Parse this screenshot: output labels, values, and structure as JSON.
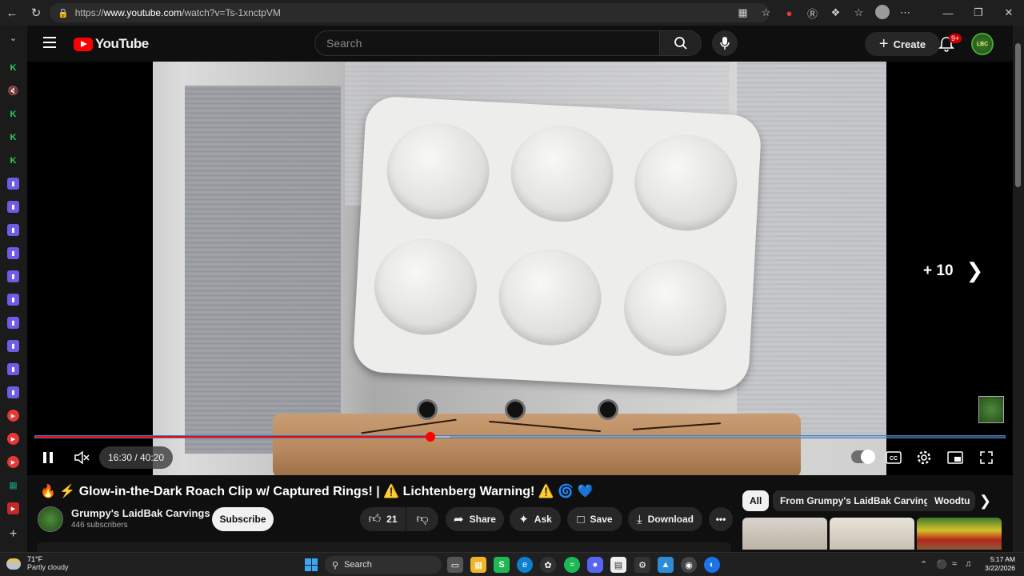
{
  "browser": {
    "url_prefix": "https://",
    "url_host": "www.youtube.com",
    "url_path": "/watch?v=Ts-1xnctpVM"
  },
  "youtube": {
    "logo_text": "YouTube",
    "search_placeholder": "Search",
    "create_label": "Create",
    "notification_count": "9+",
    "account_initials": "LBC"
  },
  "player": {
    "skip_label": "+ 10",
    "time_display": "16:30 / 40:20",
    "progress_fraction": 0.408,
    "buffered_fraction": 0.427
  },
  "video": {
    "title": "🔥 ⚡ Glow-in-the-Dark Roach Clip w/ Captured Rings! | ⚠️ Lichtenberg Warning! ⚠️ 🌀 💙",
    "channel_name": "Grumpy's LaidBak Carvings",
    "subscribers": "446 subscribers",
    "subscribe_label": "Subscribe",
    "like_count": "21",
    "share_label": "Share",
    "ask_label": "Ask",
    "save_label": "Save",
    "download_label": "Download"
  },
  "chips": [
    "All",
    "From Grumpy's LaidBak Carvings",
    "Woodtu"
  ],
  "taskbar": {
    "temperature": "71°F",
    "condition": "Partly cloudy",
    "search_label": "Search",
    "time": "5:17 AM",
    "date": "3/22/2026"
  }
}
